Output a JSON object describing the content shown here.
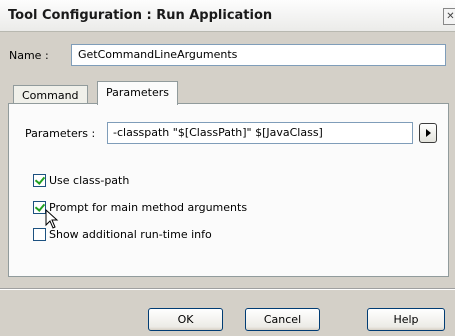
{
  "window": {
    "title": "Tool Configuration : Run Application",
    "close_label": "✕"
  },
  "name": {
    "label": "Name :",
    "value": "GetCommandLineArguments"
  },
  "tabs": [
    {
      "label": "Command",
      "selected": false
    },
    {
      "label": "Parameters",
      "selected": true
    }
  ],
  "parameters": {
    "label": "Parameters :",
    "value": "-classpath \"$[ClassPath]\" $[JavaClass]"
  },
  "options": [
    {
      "label": "Use class-path",
      "checked": true
    },
    {
      "label": "Prompt for main method arguments",
      "checked": true
    },
    {
      "label": "Show additional run-time info",
      "checked": false
    }
  ],
  "buttons": {
    "ok": "OK",
    "cancel": "Cancel",
    "help": "Help"
  },
  "icons": {
    "arrow": "play-right-icon",
    "cursor": "mouse-pointer-icon"
  }
}
